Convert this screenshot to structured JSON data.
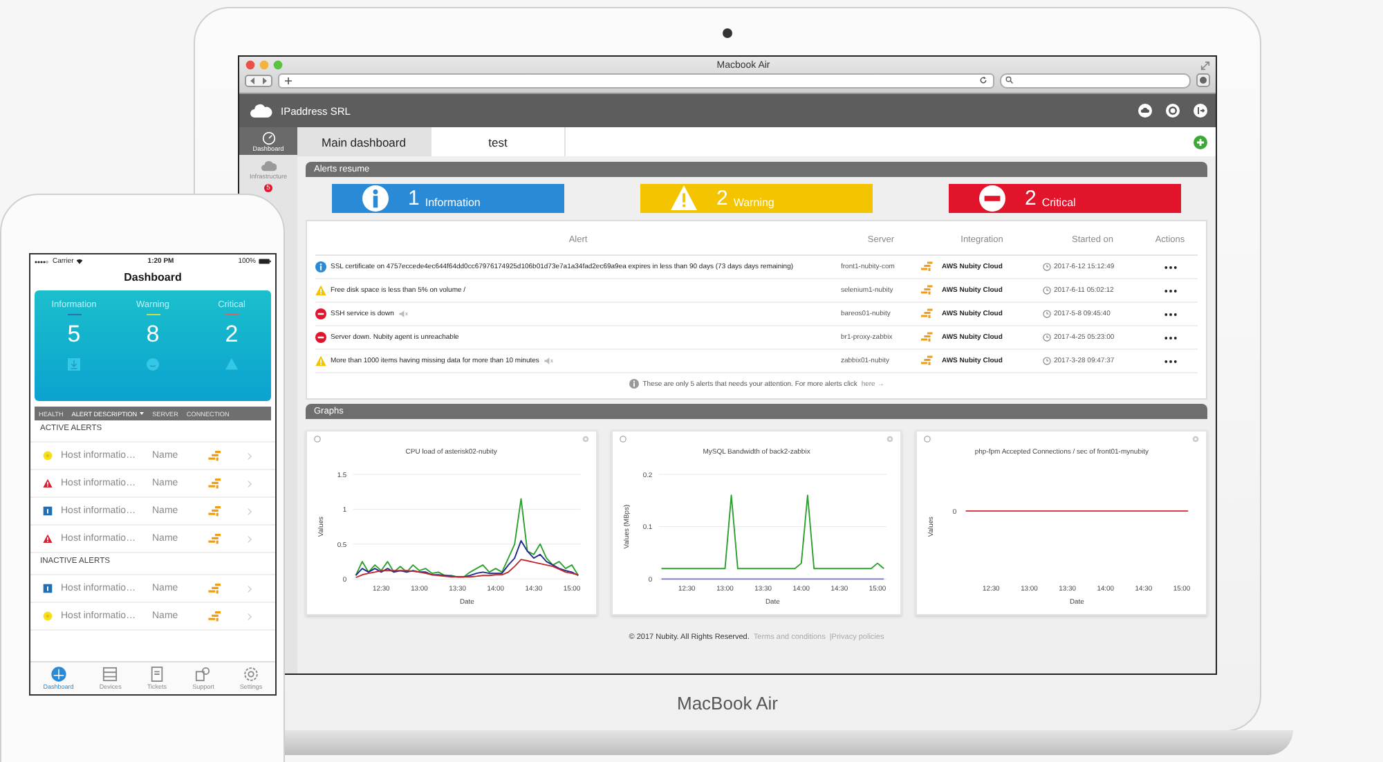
{
  "laptop": {
    "browser": {
      "title": "Macbook Air"
    },
    "app": {
      "brand": "IPaddress SRL",
      "sidebar": [
        {
          "label": "Dashboard",
          "selected": true
        },
        {
          "label": "Infrastructure",
          "selected": false
        },
        {
          "badge": "5",
          "selected": false
        }
      ],
      "tabs": [
        {
          "label": "Main dashboard",
          "selected": true
        },
        {
          "label": "test",
          "selected": false
        }
      ],
      "alerts_resume": {
        "title": "Alerts resume",
        "cards": [
          {
            "kind": "information",
            "count": "1",
            "label": "Information"
          },
          {
            "kind": "warning",
            "count": "2",
            "label": "Warning"
          },
          {
            "kind": "critical",
            "count": "2",
            "label": "Critical"
          }
        ]
      },
      "table": {
        "columns": [
          "Alert",
          "Server",
          "Integration",
          "Started on",
          "Actions"
        ],
        "rows": [
          {
            "kind": "information",
            "alert": "SSL certificate on 4757eccede4ec644f64dd0cc67976174925d106b01d73e7a1a34fad2ec69a9ea expires in less than 90 days (73 days days remaining)",
            "muted": false,
            "server": "front1-nubity-com",
            "integration": "AWS Nubity Cloud",
            "started_on": "2017-6-12 15:12:49"
          },
          {
            "kind": "warning",
            "alert": "Free disk space is less than 5% on volume /",
            "muted": false,
            "server": "selenium1-nubity",
            "integration": "AWS Nubity Cloud",
            "started_on": "2017-6-11 05:02:12"
          },
          {
            "kind": "critical",
            "alert": "SSH service is down",
            "muted": true,
            "server": "bareos01-nubity",
            "integration": "AWS Nubity Cloud",
            "started_on": "2017-5-8 09:45:40"
          },
          {
            "kind": "critical",
            "alert": "Server down. Nubity agent is unreachable",
            "muted": false,
            "server": "br1-proxy-zabbix",
            "integration": "AWS Nubity Cloud",
            "started_on": "2017-4-25 05:23:00"
          },
          {
            "kind": "warning",
            "alert": "More than 1000 items having missing data for more than 10 minutes",
            "muted": true,
            "server": "zabbix01-nubity",
            "integration": "AWS Nubity Cloud",
            "started_on": "2017-3-28 09:47:37"
          }
        ],
        "note": "These are only 5 alerts that needs your attention. For more alerts click",
        "note_link": "here →"
      },
      "graphs": {
        "title": "Graphs",
        "charts": [
          {
            "chart_data": {
              "type": "line",
              "title": "CPU load of asterisk02-nubity",
              "xlabel": "Date",
              "ylabel": "Values",
              "categories": [
                null,
                null,
                null,
                null,
                "12:30",
                null,
                null,
                null,
                null,
                null,
                "13:00",
                null,
                null,
                null,
                null,
                null,
                "13:30",
                null,
                null,
                null,
                null,
                null,
                "14:00",
                null,
                null,
                null,
                null,
                null,
                "14:30",
                null,
                null,
                null,
                null,
                null,
                "15:00",
                null
              ],
              "ylim": [
                0,
                1.5
              ],
              "yticks": [
                0,
                0.5,
                1,
                1.5
              ],
              "series": [
                {
                  "color": "#2ca02c",
                  "values": [
                    0.05,
                    0.25,
                    0.1,
                    0.2,
                    0.12,
                    0.25,
                    0.1,
                    0.18,
                    0.1,
                    0.2,
                    0.12,
                    0.15,
                    0.08,
                    0.1,
                    0.05,
                    0.05,
                    0.03,
                    0.03,
                    0.1,
                    0.15,
                    0.2,
                    0.1,
                    0.15,
                    0.1,
                    0.3,
                    0.5,
                    1.15,
                    0.4,
                    0.35,
                    0.5,
                    0.3,
                    0.2,
                    0.25,
                    0.15,
                    0.2,
                    0.05
                  ]
                },
                {
                  "color": "#1f2a8c",
                  "values": [
                    0.05,
                    0.15,
                    0.1,
                    0.15,
                    0.1,
                    0.15,
                    0.1,
                    0.12,
                    0.1,
                    0.12,
                    0.1,
                    0.1,
                    0.06,
                    0.06,
                    0.05,
                    0.04,
                    0.03,
                    0.03,
                    0.05,
                    0.08,
                    0.1,
                    0.08,
                    0.08,
                    0.08,
                    0.2,
                    0.3,
                    0.55,
                    0.4,
                    0.3,
                    0.35,
                    0.25,
                    0.2,
                    0.15,
                    0.12,
                    0.1,
                    0.05
                  ]
                },
                {
                  "color": "#c0282d",
                  "values": [
                    0.02,
                    0.06,
                    0.08,
                    0.1,
                    0.12,
                    0.12,
                    0.12,
                    0.12,
                    0.12,
                    0.11,
                    0.1,
                    0.08,
                    0.06,
                    0.05,
                    0.04,
                    0.03,
                    0.03,
                    0.03,
                    0.03,
                    0.04,
                    0.05,
                    0.05,
                    0.06,
                    0.06,
                    0.1,
                    0.18,
                    0.28,
                    0.26,
                    0.24,
                    0.22,
                    0.2,
                    0.18,
                    0.14,
                    0.1,
                    0.08,
                    0.06
                  ]
                }
              ]
            }
          },
          {
            "chart_data": {
              "type": "line",
              "title": "MySQL Bandwidth of back2-zabbix",
              "xlabel": "Date",
              "ylabel": "Values (MBps)",
              "categories": [
                null,
                null,
                null,
                null,
                "12:30",
                null,
                null,
                null,
                null,
                null,
                "13:00",
                null,
                null,
                null,
                null,
                null,
                "13:30",
                null,
                null,
                null,
                null,
                null,
                "14:00",
                null,
                null,
                null,
                null,
                null,
                "14:30",
                null,
                null,
                null,
                null,
                null,
                "15:00",
                null
              ],
              "ylim": [
                0,
                0.2
              ],
              "yticks": [
                0,
                0.1,
                0.2
              ],
              "series": [
                {
                  "color": "#2ca02c",
                  "values": [
                    0.02,
                    0.02,
                    0.02,
                    0.02,
                    0.02,
                    0.02,
                    0.02,
                    0.02,
                    0.02,
                    0.02,
                    0.02,
                    0.16,
                    0.02,
                    0.02,
                    0.02,
                    0.02,
                    0.02,
                    0.02,
                    0.02,
                    0.02,
                    0.02,
                    0.02,
                    0.03,
                    0.16,
                    0.02,
                    0.02,
                    0.02,
                    0.02,
                    0.02,
                    0.02,
                    0.02,
                    0.02,
                    0.02,
                    0.02,
                    0.03,
                    0.02
                  ]
                },
                {
                  "color": "#6f6fe0",
                  "values": [
                    0,
                    0,
                    0,
                    0,
                    0,
                    0,
                    0,
                    0,
                    0,
                    0,
                    0,
                    0,
                    0,
                    0,
                    0,
                    0,
                    0,
                    0,
                    0,
                    0,
                    0,
                    0,
                    0,
                    0,
                    0,
                    0,
                    0,
                    0,
                    0,
                    0,
                    0,
                    0,
                    0,
                    0,
                    0,
                    0
                  ]
                }
              ]
            }
          },
          {
            "picture": {
              "title": "php-fpm Accepted Connections / sec of front01-mynubity",
              "xlabel": "Date",
              "ylabel": "Values",
              "y_tick": "0",
              "x_ticks": [
                "12:30",
                "13:00",
                "13:30",
                "14:00",
                "14:30",
                "15:00"
              ]
            }
          }
        ]
      },
      "footer": {
        "copyright": "© 2017 Nubity. All Rights Reserved.",
        "links": [
          "Terms and conditions",
          "|Privacy policies"
        ]
      }
    },
    "device_label": "MacBook Air"
  },
  "phone": {
    "status_bar": {
      "carrier": "Carrier",
      "time": "1:20 PM",
      "battery": "100%"
    },
    "title": "Dashboard",
    "summary": [
      {
        "kind": "information",
        "label": "Information",
        "count": "5"
      },
      {
        "kind": "warning",
        "label": "Warning",
        "count": "8"
      },
      {
        "kind": "critical",
        "label": "Critical",
        "count": "2"
      }
    ],
    "columns": [
      {
        "label": "HEALTH",
        "selected": false
      },
      {
        "label": "ALERT DESCRIPTION",
        "selected": true
      },
      {
        "label": "SERVER",
        "selected": false
      },
      {
        "label": "CONNECTION",
        "selected": false
      }
    ],
    "sections": [
      {
        "title": "ACTIVE ALERTS",
        "rows": [
          {
            "kind": "warning",
            "description": "Host informatio…",
            "name": "Name"
          },
          {
            "kind": "critical",
            "description": "Host informatio…",
            "name": "Name"
          },
          {
            "kind": "information",
            "description": "Host informatio…",
            "name": "Name"
          },
          {
            "kind": "critical",
            "description": "Host informatio…",
            "name": "Name"
          }
        ]
      },
      {
        "title": "INACTIVE ALERTS",
        "rows": [
          {
            "kind": "information",
            "description": "Host informatio…",
            "name": "Name"
          },
          {
            "kind": "warning",
            "description": "Host informatio…",
            "name": "Name"
          }
        ]
      }
    ],
    "tab_bar": [
      {
        "label": "Dashboard",
        "selected": true
      },
      {
        "label": "Devices",
        "selected": false
      },
      {
        "label": "Tickets",
        "selected": false
      },
      {
        "label": "Support",
        "selected": false
      },
      {
        "label": "Settings",
        "selected": false
      }
    ]
  }
}
